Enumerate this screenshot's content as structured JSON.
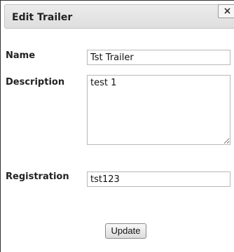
{
  "dialog": {
    "title": "Edit Trailer",
    "close_label": "×"
  },
  "form": {
    "name_label": "Name",
    "name_value": "Tst Trailer",
    "description_label": "Description",
    "description_value": "test 1",
    "registration_label": "Registration",
    "registration_value": "tst123",
    "submit_label": "Update"
  }
}
